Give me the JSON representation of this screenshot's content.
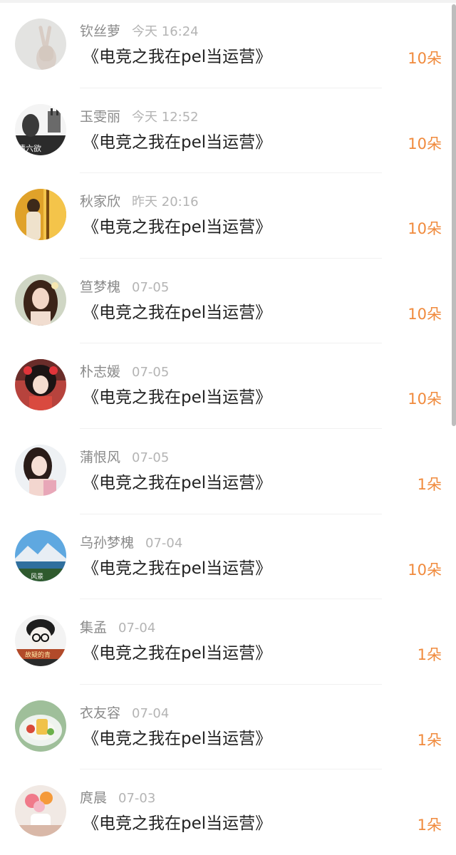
{
  "records": [
    {
      "name": "钦丝萝",
      "time": "今天 16:24",
      "book": "《电竞之我在pel当运营》",
      "amount": "10朵",
      "avatar_icon": "avatar-victory-hand-photo"
    },
    {
      "name": "玉雯丽",
      "time": "今天 12:52",
      "book": "《电竞之我在pel当运营》",
      "amount": "10朵",
      "avatar_icon": "avatar-bw-text-photo",
      "avatar_overlay": "情六欲"
    },
    {
      "name": "秋家欣",
      "time": "昨天 20:16",
      "book": "《电竞之我在pel当运营》",
      "amount": "10朵",
      "avatar_icon": "avatar-golden-portrait"
    },
    {
      "name": "笪梦槐",
      "time": "07-05",
      "book": "《电竞之我在pel当运营》",
      "amount": "10朵",
      "avatar_icon": "avatar-girl-portrait"
    },
    {
      "name": "朴志媛",
      "time": "07-05",
      "book": "《电竞之我在pel当运营》",
      "amount": "10朵",
      "avatar_icon": "avatar-anime-girl"
    },
    {
      "name": "蒲恨风",
      "time": "07-05",
      "book": "《电竞之我在pel当运营》",
      "amount": "1朵",
      "avatar_icon": "avatar-woman-portrait"
    },
    {
      "name": "乌孙梦槐",
      "time": "07-04",
      "book": "《电竞之我在pel当运营》",
      "amount": "10朵",
      "avatar_icon": "avatar-landscape",
      "avatar_overlay": "风景"
    },
    {
      "name": "集孟",
      "time": "07-04",
      "book": "《电竞之我在pel当运营》",
      "amount": "1朵",
      "avatar_icon": "avatar-cartoon-glasses-boy",
      "avatar_overlay": "故疑的青"
    },
    {
      "name": "衣友容",
      "time": "07-04",
      "book": "《电竞之我在pel当运营》",
      "amount": "1朵",
      "avatar_icon": "avatar-food-plate"
    },
    {
      "name": "庹晨",
      "time": "07-03",
      "book": "《电竞之我在pel当运营》",
      "amount": "1朵",
      "avatar_icon": "avatar-flower-vase"
    }
  ],
  "colors": {
    "amount": "#f08a3c",
    "name": "#8a8a8a",
    "time": "#b4b4b4",
    "book": "#222222"
  }
}
